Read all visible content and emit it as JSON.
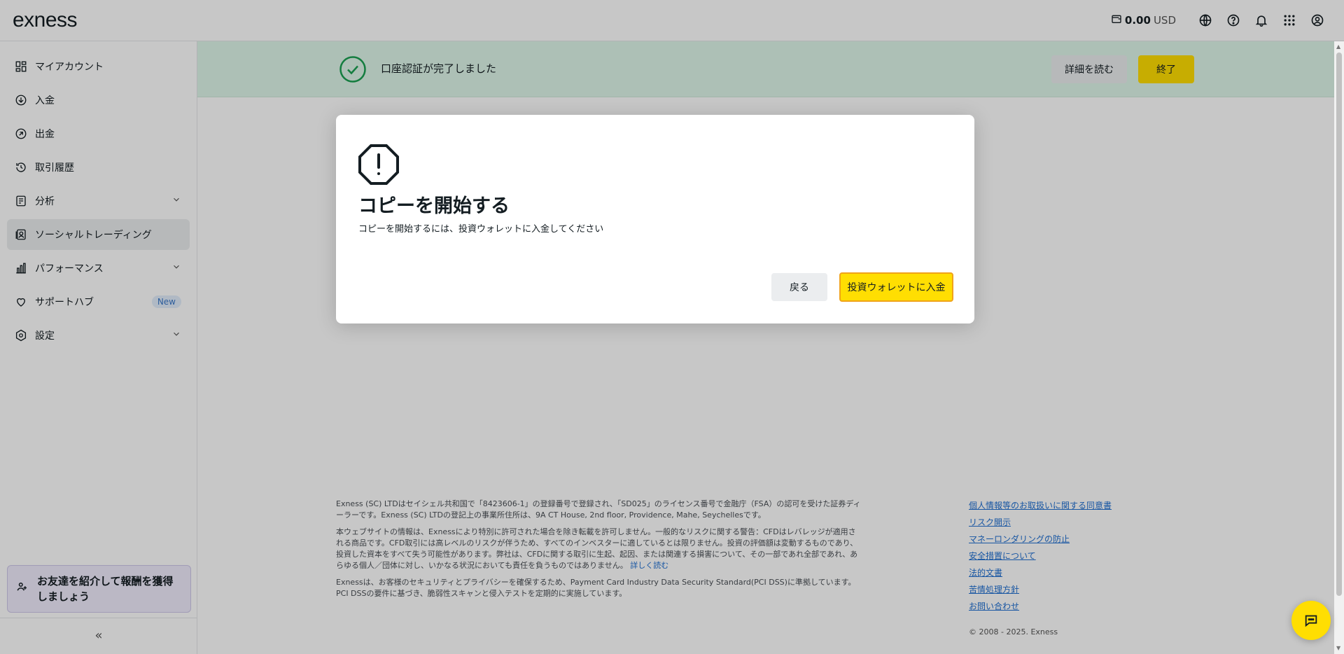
{
  "header": {
    "logo": "exness",
    "balance_amount": "0.00",
    "balance_currency": "USD",
    "icons": [
      "wallet-icon",
      "globe-icon",
      "help-icon",
      "bell-icon",
      "apps-grid-icon",
      "account-icon"
    ]
  },
  "sidebar": {
    "items": [
      {
        "label": "マイアカウント",
        "icon": "dashboard-icon"
      },
      {
        "label": "入金",
        "icon": "deposit-icon"
      },
      {
        "label": "出金",
        "icon": "withdraw-icon"
      },
      {
        "label": "取引履歴",
        "icon": "history-icon"
      },
      {
        "label": "分析",
        "icon": "analytics-icon"
      },
      {
        "label": "ソーシャルトレーディング",
        "icon": "social-trading-icon"
      },
      {
        "label": "パフォーマンス",
        "icon": "performance-icon"
      },
      {
        "label": "サポートハブ",
        "icon": "heart-icon",
        "badge": "New"
      },
      {
        "label": "設定",
        "icon": "settings-icon"
      }
    ],
    "referral": "お友達を紹介して報酬を獲得しましょう",
    "collapse": "«"
  },
  "banner": {
    "text": "口座認証が完了しました",
    "detail_button": "詳細を読む",
    "close_button": "終了"
  },
  "dialog": {
    "title": "コピーを開始する",
    "subtitle": "コピーを開始するには、投資ウォレットに入金してください",
    "back_button": "戻る",
    "deposit_button": "投資ウォレットに入金"
  },
  "footer": {
    "para1": "Exness (SC) LTDはセイシェル共和国で「8423606-1」の登録番号で登録され、「SD025」のライセンス番号で金融庁（FSA）の認可を受けた証券ディーラーです。Exness (SC) LTDの登記上の事業所住所は、9A CT House, 2nd floor, Providence, Mahe, Seychellesです。",
    "para2": "本ウェブサイトの情報は、Exnessにより特別に許可された場合を除き転載を許可しません。一般的なリスクに関する警告：CFDはレバレッジが適用される商品です。CFD取引には高レベルのリスクが伴うため、すべてのインベスターに適しているとは限りません。投資の評価額は変動するものであり、投資した資本をすべて失う可能性があります。弊社は、CFDに関する取引に生起、起因、または関連する損害について、その一部であれ全部であれ、あらゆる個人／団体に対し、いかなる状況においても責任を負うものではありません。",
    "more_link": "詳しく読む",
    "para3": "Exnessは、お客様のセキュリティとプライバシーを確保するため、Payment Card Industry Data Security Standard(PCI DSS)に準拠しています。PCI DSSの要件に基づき、脆弱性スキャンと侵入テストを定期的に実施しています。",
    "links": [
      "個人情報等のお取扱いに関する同意書",
      "リスク開示",
      "マネーロンダリングの防止",
      "安全措置について",
      "法的文書",
      "苦情処理方針",
      "お問い合わせ"
    ],
    "copyright": "© 2008 - 2025. Exness"
  },
  "colors": {
    "accent_yellow": "#ffde02",
    "banner_green": "#def7ea",
    "success_green": "#1aa051",
    "link_blue": "#1f6fd1"
  }
}
